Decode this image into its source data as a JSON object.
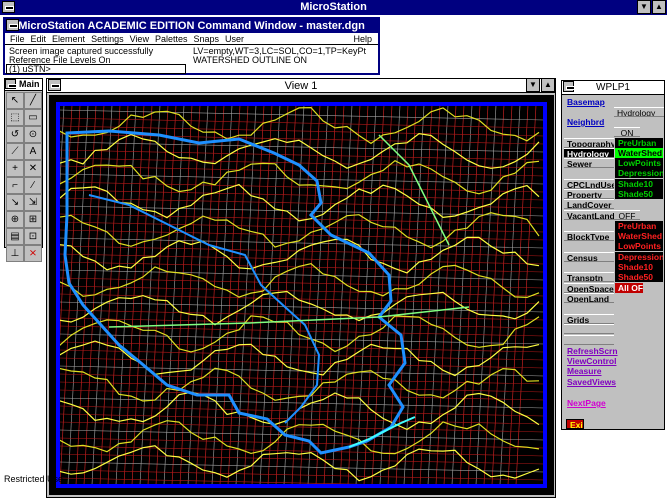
{
  "app": {
    "title": "MicroStation"
  },
  "command_window": {
    "title": "MicroStation ACADEMIC EDITION Command Window - master.dgn",
    "menu": [
      "File",
      "Edit",
      "Element",
      "Settings",
      "View",
      "Palettes",
      "Snaps",
      "User",
      "Help"
    ],
    "message_left_1": "Screen image captured successfully",
    "message_left_2": "Reference File Levels On",
    "message_right_1": "LV=empty,WT=3,LC=SOL,CO=1,TP=KeyPt",
    "message_right_2": "WATERSHED OUTLINE ON",
    "keyin_prompt": "(1) uSTN>"
  },
  "main_palette": {
    "title": "Main",
    "tools": [
      "↖",
      "╱",
      "⬚",
      "▭",
      "↺",
      "⊙",
      "⟋",
      "A",
      "+",
      "✕",
      "⌐",
      "∕",
      "↘",
      "⇲",
      "⊕",
      "⊞",
      "▤",
      "⊡",
      "⊥",
      "⨯"
    ]
  },
  "view_window": {
    "title": "View 1"
  },
  "wplp": {
    "title": "WPLP1",
    "basemap": "Basemap",
    "hydrology_title": "Hydrology",
    "neighbrd": "Neighbrd",
    "on_label": "ON",
    "left": [
      "Topography",
      "Hydrology",
      "Sewer",
      "CPCLndUse",
      "Property",
      "LandCover",
      "VacantLand",
      "BlockType",
      "Census",
      "Transptn",
      "OpenSpace",
      "OpenLand",
      "Grids"
    ],
    "on_items": [
      "PreUrban",
      "WaterShed",
      "LowPoints",
      "Depressions",
      "Shade10",
      "Shade50"
    ],
    "off_label": "OFF",
    "off_items": [
      "PreUrban",
      "WaterShed",
      "LowPoints",
      "Depressions",
      "Shade10",
      "Shade50",
      "All OFF"
    ],
    "actions": [
      "RefreshScrn",
      "ViewControl",
      "Measure",
      "SavedViews"
    ],
    "next_page": "NextPage",
    "exit": "Exit"
  },
  "status_bar": {
    "text": "Restricted Use"
  },
  "colors": {
    "title_bar": "#000080",
    "view_border": "#0000ff",
    "watershed": "#1e90ff",
    "contours": "#ffff40",
    "streets": "#ff3030"
  }
}
